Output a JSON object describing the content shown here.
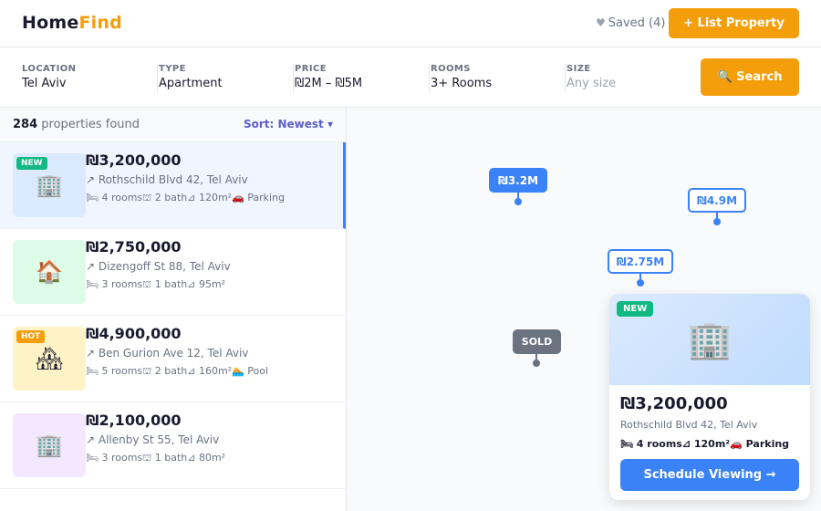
{
  "header": {
    "logo_part1": "Home",
    "logo_part2": "Find",
    "saved_label": "Saved (4)",
    "list_property_label": "+ List Property"
  },
  "filters": {
    "location": {
      "label": "LOCATION",
      "value": "Tel Aviv"
    },
    "type": {
      "label": "TYPE",
      "value": "Apartment"
    },
    "price": {
      "label": "PRICE",
      "value": "₪2M – ₪5M"
    },
    "rooms": {
      "label": "ROOMS",
      "value": "3+ Rooms"
    },
    "size": {
      "label": "SIZE",
      "placeholder": "Any size"
    },
    "search_label": "🔍 Search"
  },
  "results": {
    "count": "284",
    "count_suffix": " properties found",
    "sort_label": "Sort: Newest ▾"
  },
  "listings": [
    {
      "price": "₪3,200,000",
      "address": "↗ Rothschild Blvd 42, Tel Aviv",
      "features": "🛏 4 rooms⛫ 2 bath⊿ 120m²🚗 Parking",
      "badge": "NEW",
      "badge_color": "#10b981",
      "thumb_icon": "🏢",
      "thumb_color": "#dbeafe",
      "active": true
    },
    {
      "price": "₪2,750,000",
      "address": "↗ Dizengoff St 88, Tel Aviv",
      "features": "🛏 3 rooms⛫ 1 bath⊿ 95m²",
      "badge": "",
      "badge_color": "",
      "thumb_icon": "🏠",
      "thumb_color": "#dcfce7",
      "active": false
    },
    {
      "price": "₪4,900,000",
      "address": "↗ Ben Gurion Ave 12, Tel Aviv",
      "features": "🛏 5 rooms⛫ 2 bath⊿ 160m²🏊 Pool",
      "badge": "HOT",
      "badge_color": "#f59e0b",
      "thumb_icon": "🏘",
      "thumb_color": "#fef3c7",
      "active": false
    },
    {
      "price": "₪2,100,000",
      "address": "↗ Allenby St 55, Tel Aviv",
      "features": "🛏 3 rooms⛫ 1 bath⊿ 80m²",
      "badge": "",
      "badge_color": "",
      "thumb_icon": "🏢",
      "thumb_color": "#f3e8ff",
      "active": false
    }
  ],
  "map_pins": [
    {
      "label": "₪3.2M",
      "style": "solid"
    },
    {
      "label": "₪4.9M",
      "style": "outline"
    },
    {
      "label": "₪2.75M",
      "style": "outline"
    },
    {
      "label": "SOLD",
      "style": "sold"
    }
  ],
  "popup": {
    "badge": "NEW",
    "image_icon": "🏢",
    "price": "₪3,200,000",
    "address": "Rothschild Blvd 42, Tel Aviv",
    "features": "🛏 4 rooms⊿ 120m²🚗 Parking",
    "button_label": "Schedule Viewing →"
  },
  "colors": {
    "accent": "#f59e0b",
    "primary": "#3b82f6",
    "sold": "#6b7280",
    "new_badge": "#10b981"
  }
}
